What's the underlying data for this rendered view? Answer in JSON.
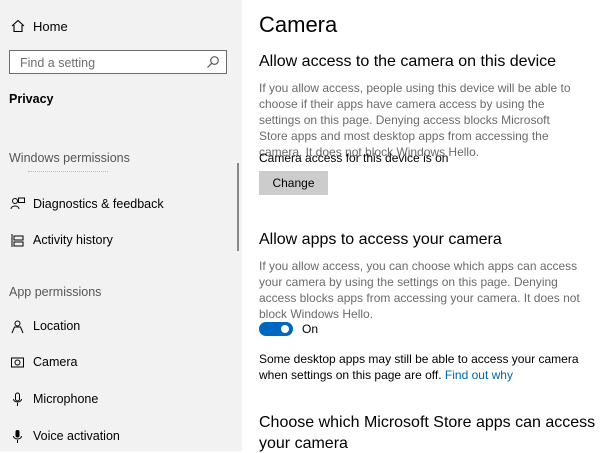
{
  "sidebar": {
    "home_label": "Home",
    "search_placeholder": "Find a setting",
    "section_title": "Privacy",
    "windows_permissions_label": "Windows permissions",
    "app_permissions_label": "App permissions",
    "windows_items": [
      {
        "label": "Diagnostics & feedback",
        "icon": "feedback-icon"
      },
      {
        "label": "Activity history",
        "icon": "timeline-icon"
      }
    ],
    "app_items": [
      {
        "label": "Location",
        "icon": "location-icon"
      },
      {
        "label": "Camera",
        "icon": "camera-icon"
      },
      {
        "label": "Microphone",
        "icon": "microphone-icon"
      },
      {
        "label": "Voice activation",
        "icon": "voice-icon"
      }
    ]
  },
  "main": {
    "title": "Camera",
    "device_section": {
      "heading": "Allow access to the camera on this device",
      "description": "If you allow access, people using this device will be able to choose if their apps have camera access by using the settings on this page. Denying access blocks Microsoft Store apps and most desktop apps from accessing the camera. It does not block Windows Hello.",
      "status": "Camera access for this device is on",
      "change_button": "Change"
    },
    "apps_section": {
      "heading": "Allow apps to access your camera",
      "description": "If you allow access, you can choose which apps can access your camera by using the settings on this page. Denying access blocks apps from accessing your camera. It does not block Windows Hello.",
      "toggle_state": "On",
      "note": "Some desktop apps may still be able to access your camera when settings on this page are off.",
      "link": "Find out why"
    },
    "store_section": {
      "heading_line1": "Choose which Microsoft Store apps can access",
      "heading_line2": "your camera"
    }
  },
  "colors": {
    "accent": "#0067c0",
    "sidebar_bg": "#f2f2f2",
    "button_bg": "#cccccc",
    "link": "#0064b4"
  }
}
